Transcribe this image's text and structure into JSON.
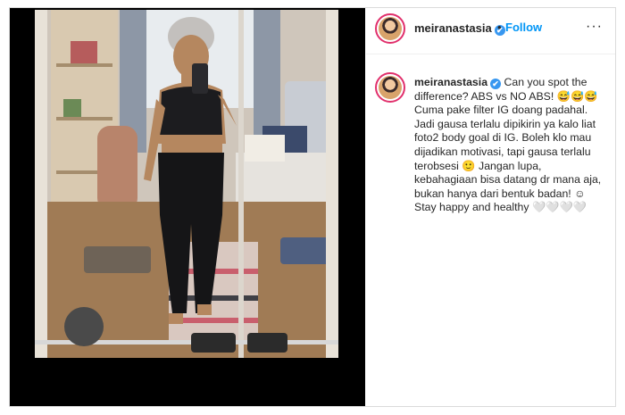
{
  "post": {
    "username": "meiranastasia",
    "verified_icon": "✔",
    "separator": "•",
    "follow_label": "Follow",
    "more_icon": "···",
    "caption": "Can you spot the difference? ABS vs NO ABS! 😅😅😅 Cuma pake filter IG doang padahal. Jadi gausa terlalu dipikirin ya kalo liat foto2 body goal di IG. Boleh klo mau dijadikan motivasi, tapi gausa terlalu terobsesi 🙂 Jangan lupa, kebahagiaan bisa datang dr mana aja, bukan hanya dari bentuk badan! ☺ Stay happy and healthy 🤍🤍🤍🤍"
  },
  "colors": {
    "follow": "#0095f6",
    "verified": "#3897f0",
    "avatar_ring": "#e1306c",
    "media_bg": "#000000"
  }
}
